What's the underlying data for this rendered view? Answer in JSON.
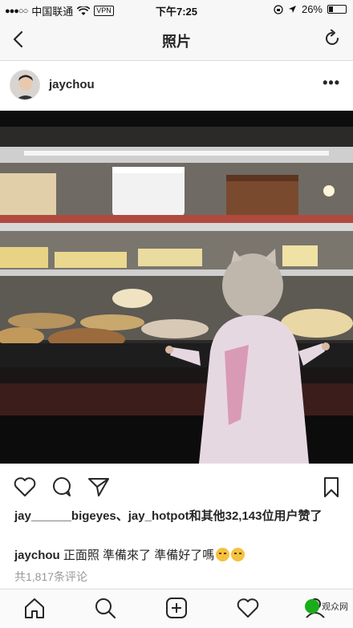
{
  "status_bar": {
    "signal_dots": "●●●○○",
    "carrier": "中国联通",
    "vpn": "VPN",
    "time": "下午7:25",
    "battery_percent": "26%",
    "battery_level": 0.26
  },
  "nav": {
    "title": "照片",
    "back_icon": "chevron-left-icon",
    "refresh_icon": "refresh-icon"
  },
  "post": {
    "username": "jaychou",
    "more": "•••",
    "likes_text": "jay______bigeyes、jay_hotpot和其他32,143位用户赞了",
    "caption_user": "jaychou",
    "caption_text": " 正面照 準備來了 準備好了嗎",
    "comments": "共1,817条评论"
  },
  "actions": [
    "heart-icon",
    "comment-icon",
    "share-icon",
    "bookmark-icon"
  ],
  "tabs": [
    "home-icon",
    "search-icon",
    "add-icon",
    "activity-icon",
    "profile-icon"
  ],
  "watermark": {
    "text": "观众网"
  },
  "colors": {
    "bar_bg": "#f7f7f7",
    "text": "#262626",
    "muted": "#999999"
  }
}
